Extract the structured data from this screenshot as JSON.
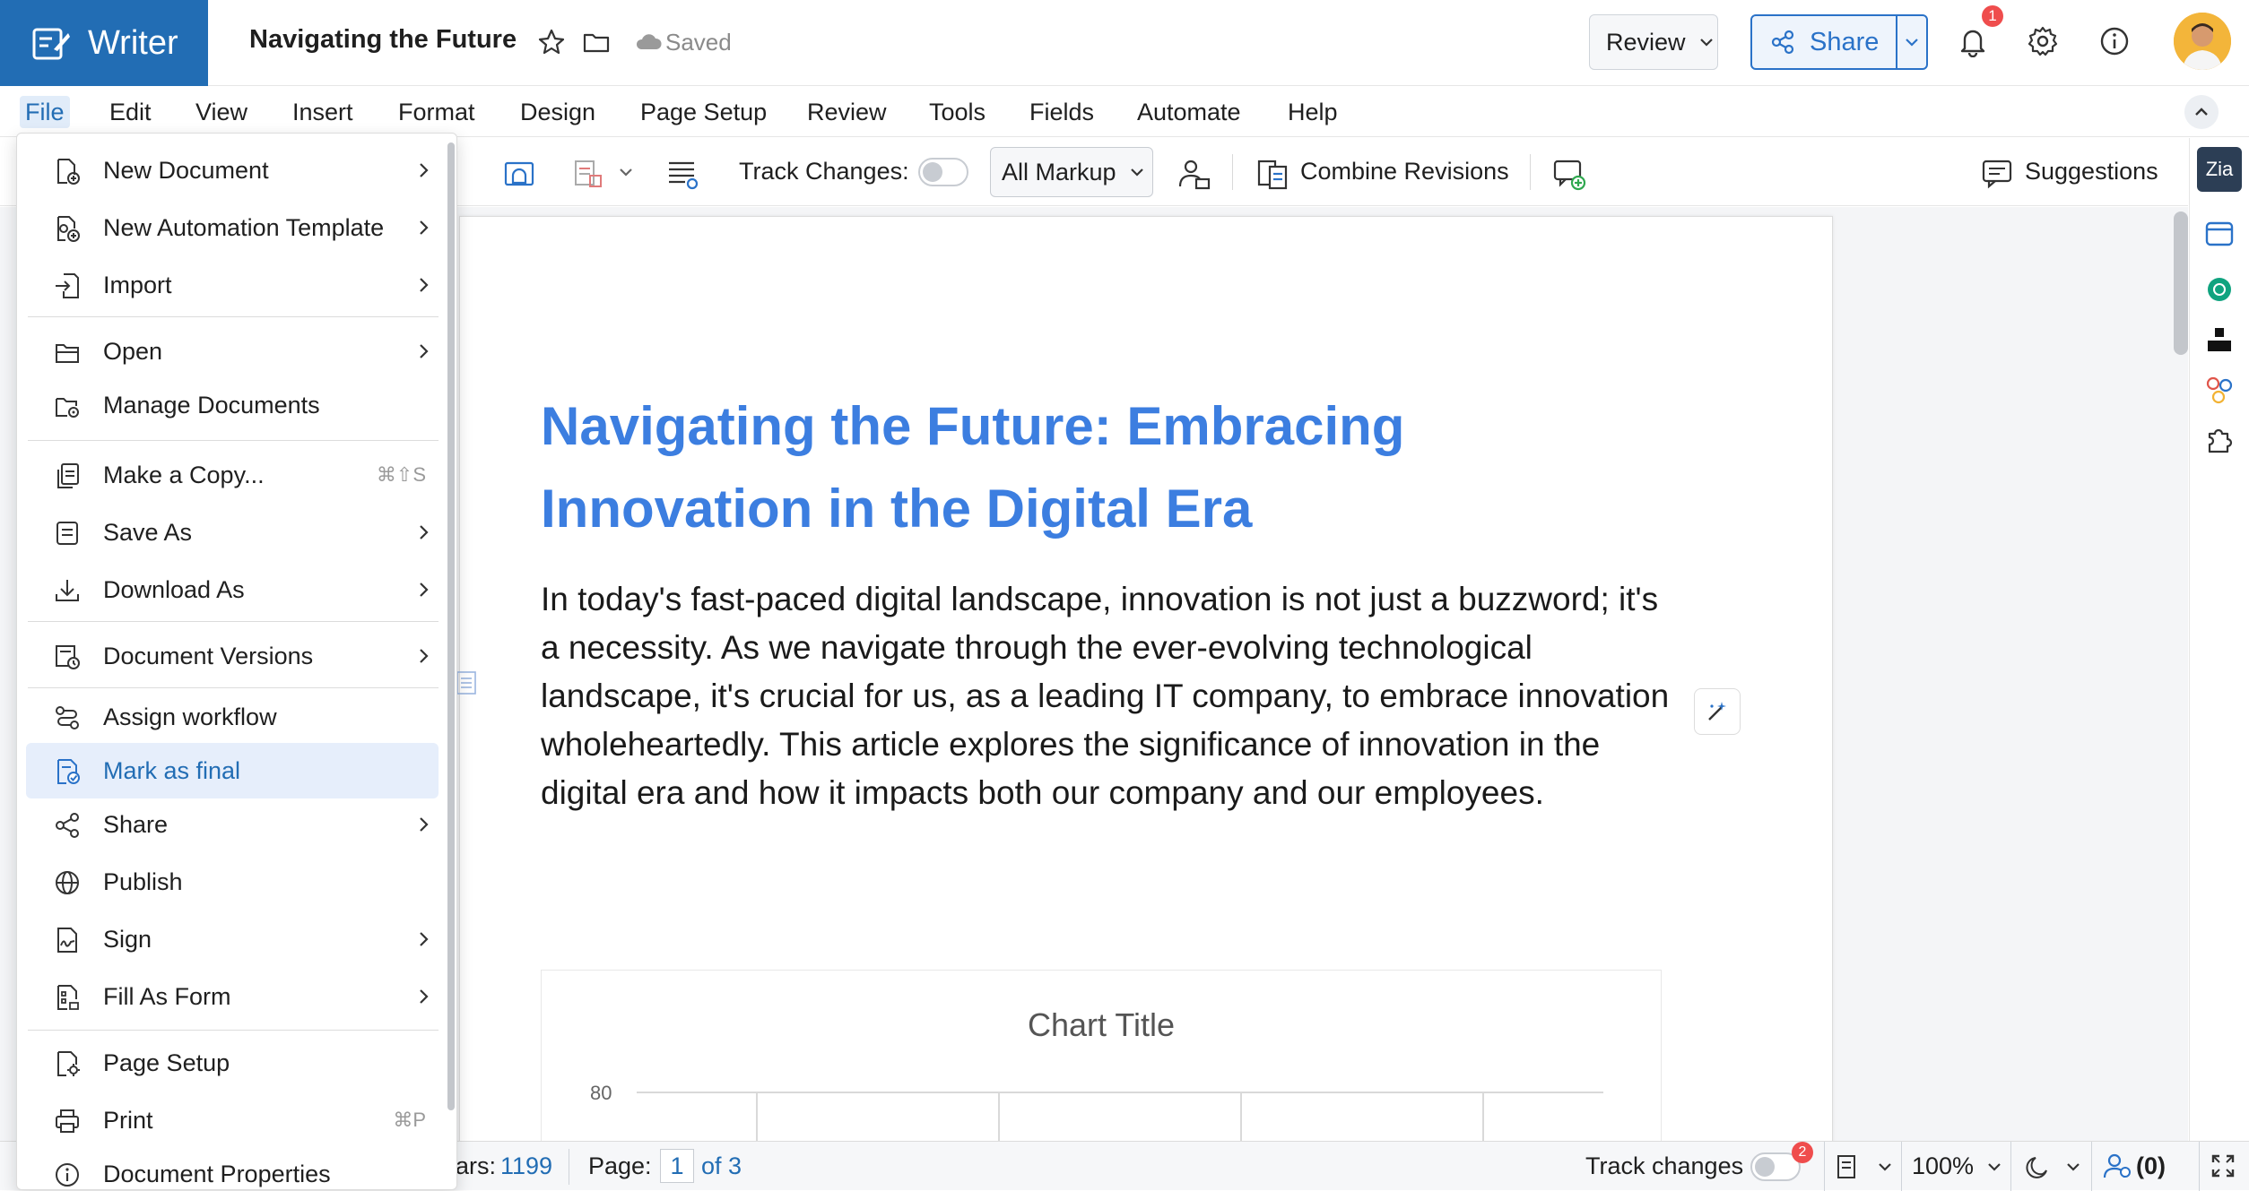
{
  "app": {
    "name": "Writer",
    "doc_title": "Navigating the Future",
    "save_status": "Saved"
  },
  "header": {
    "review_label": "Review",
    "share_label": "Share",
    "notification_count": "1"
  },
  "menubar": {
    "items": [
      "File",
      "Edit",
      "View",
      "Insert",
      "Format",
      "Design",
      "Page Setup",
      "Review",
      "Tools",
      "Fields",
      "Automate",
      "Help"
    ]
  },
  "toolbar": {
    "track_changes_label": "Track Changes:",
    "markup_value": "All Markup",
    "combine_revisions_label": "Combine Revisions",
    "suggestions_label": "Suggestions"
  },
  "document": {
    "heading": "Navigating the Future: Embracing Innovation in the Digital Era",
    "paragraph": "In today's fast-paced digital landscape, innovation is not just a buzzword; it's a necessity. As we navigate through the ever-evolving technological landscape, it's crucial for us, as a leading IT company, to embrace innovation wholeheartedly. This article explores the significance of innovation in the digital era and how it impacts both our company and our employees.",
    "chart": {
      "title": "Chart Title",
      "y_tick_top": "80"
    }
  },
  "file_menu": {
    "items": [
      {
        "label": "New Document",
        "icon": "new-document-icon",
        "submenu": true
      },
      {
        "label": "New Automation Template",
        "icon": "automation-template-icon",
        "submenu": true
      },
      {
        "label": "Import",
        "icon": "import-icon",
        "submenu": true
      },
      {
        "label": "Open",
        "icon": "open-icon",
        "submenu": true
      },
      {
        "label": "Manage Documents",
        "icon": "manage-documents-icon"
      },
      {
        "label": "Make a Copy...",
        "icon": "copy-icon",
        "shortcut": "⌘⇧S"
      },
      {
        "label": "Save As",
        "icon": "save-as-icon",
        "submenu": true
      },
      {
        "label": "Download As",
        "icon": "download-icon",
        "submenu": true
      },
      {
        "label": "Document Versions",
        "icon": "versions-icon",
        "submenu": true
      },
      {
        "label": "Assign workflow",
        "icon": "workflow-icon"
      },
      {
        "label": "Mark as final",
        "icon": "mark-final-icon",
        "highlighted": true
      },
      {
        "label": "Share",
        "icon": "share-icon",
        "submenu": true
      },
      {
        "label": "Publish",
        "icon": "globe-icon"
      },
      {
        "label": "Sign",
        "icon": "sign-icon",
        "submenu": true
      },
      {
        "label": "Fill As Form",
        "icon": "form-icon",
        "submenu": true
      },
      {
        "label": "Page Setup",
        "icon": "page-setup-icon"
      },
      {
        "label": "Print",
        "icon": "print-icon",
        "shortcut": "⌘P"
      },
      {
        "label": "Document Properties",
        "icon": "info-icon"
      }
    ]
  },
  "statusbar": {
    "chars_label": "ars:",
    "chars_value": "1199",
    "page_label": "Page:",
    "page_current": "1",
    "page_total": "of 3",
    "track_changes_label": "Track changes",
    "track_badge": "2",
    "zoom": "100%",
    "collab_count": "(0)"
  },
  "colors": {
    "brand": "#226DB4",
    "heading": "#3c7ee0",
    "share": "#2a72c8"
  }
}
